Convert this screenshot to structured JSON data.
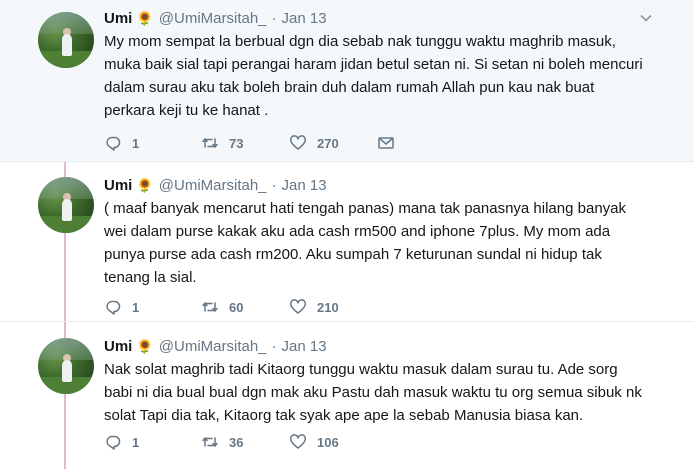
{
  "tweets": [
    {
      "name": "Umi",
      "emoji": "🌻",
      "handle": "@UmiMarsitah_",
      "separator": "·",
      "time": "Jan 13",
      "text": "My mom sempat la berbual dgn dia sebab nak tunggu waktu maghrib masuk, muka baik sial tapi perangai haram jidan betul setan ni. Si setan ni boleh mencuri dalam surau aku tak boleh brain duh dalam rumah Allah pun kau nak buat perkara keji tu ke hanat .",
      "replies": "1",
      "retweets": "73",
      "likes": "270"
    },
    {
      "name": "Umi",
      "emoji": "🌻",
      "handle": "@UmiMarsitah_",
      "separator": "·",
      "time": "Jan 13",
      "text": "( maaf banyak mencarut hati tengah panas)  mana tak panasnya hilang banyak wei dalam purse kakak aku ada cash rm500 and iphone 7plus. My mom ada punya purse ada cash rm200. Aku sumpah 7 keturunan sundal ni hidup tak tenang la sial.",
      "replies": "1",
      "retweets": "60",
      "likes": "210"
    },
    {
      "name": "Umi",
      "emoji": "🌻",
      "handle": "@UmiMarsitah_",
      "separator": "·",
      "time": "Jan 13",
      "text": "Nak solat maghrib tadi Kitaorg tunggu waktu masuk dalam surau tu. Ade sorg babi ni dia bual bual dgn mak aku Pastu dah masuk waktu tu org semua sibuk nk solat Tapi dia tak, Kitaorg tak syak ape ape la sebab Manusia biasa kan.",
      "replies": "1",
      "retweets": "36",
      "likes": "106"
    }
  ],
  "icons": {
    "reply": "reply-icon",
    "retweet": "retweet-icon",
    "like": "heart-icon",
    "dm": "envelope-icon",
    "menu": "chevron-down-icon"
  },
  "colors": {
    "thread_line": "#e1b7d3",
    "secondary_text": "#657786",
    "highlight_bg": "#f5f8fa"
  }
}
